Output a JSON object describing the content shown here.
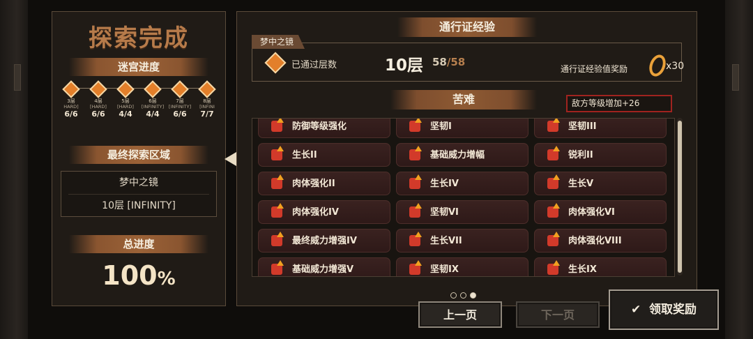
{
  "left": {
    "title": "探索完成",
    "maze_progress_label": "迷宫进度",
    "maze_nodes": [
      {
        "level": "3层",
        "difficulty": "HARD]",
        "count": "6/6"
      },
      {
        "level": "4层",
        "difficulty": "[HARD]",
        "count": "6/6"
      },
      {
        "level": "5层",
        "difficulty": "[HARD]",
        "count": "4/4"
      },
      {
        "level": "6层",
        "difficulty": "[INFINITY]",
        "count": "4/4"
      },
      {
        "level": "7层",
        "difficulty": "[INFINITY]",
        "count": "6/6"
      },
      {
        "level": "8层",
        "difficulty": "[INFINI",
        "count": "7/7"
      }
    ],
    "final_area_label": "最终探索区域",
    "final_area_name": "梦中之镜",
    "final_area_floor": "10层 [INFINITY]",
    "total_progress_label": "总进度",
    "total_progress_value": "100",
    "total_progress_unit": "%"
  },
  "right": {
    "pass_exp_title": "通行证经验",
    "dream_tag": "梦中之镜",
    "passed_label": "已通过层数",
    "floors": "10层",
    "ratio_current": "58",
    "ratio_total": "/58",
    "exp_reward_label": "通行证经验值奖励",
    "exp_reward_value": "x30",
    "hardship_title": "苦难",
    "enemy_level_note": "敌方等级增加+26",
    "hardships": [
      "防御等级强化",
      "坚韧I",
      "坚韧III",
      "生长II",
      "基础威力增幅",
      "锐利II",
      "肉体强化II",
      "生长IV",
      "生长V",
      "肉体强化IV",
      "坚韧VI",
      "肉体强化VI",
      "最终威力增强IV",
      "生长VII",
      "肉体强化VIII",
      "基础威力增强V",
      "坚韧IX",
      "生长IX"
    ],
    "page_dots": [
      false,
      false,
      true
    ]
  },
  "buttons": {
    "prev": "上一页",
    "next": "下一页",
    "claim": "领取奖励",
    "claim_icon": "✔"
  },
  "colors": {
    "accent": "#e37f2a",
    "warning_border": "#a0231f",
    "card_bg": "#3a2220"
  }
}
